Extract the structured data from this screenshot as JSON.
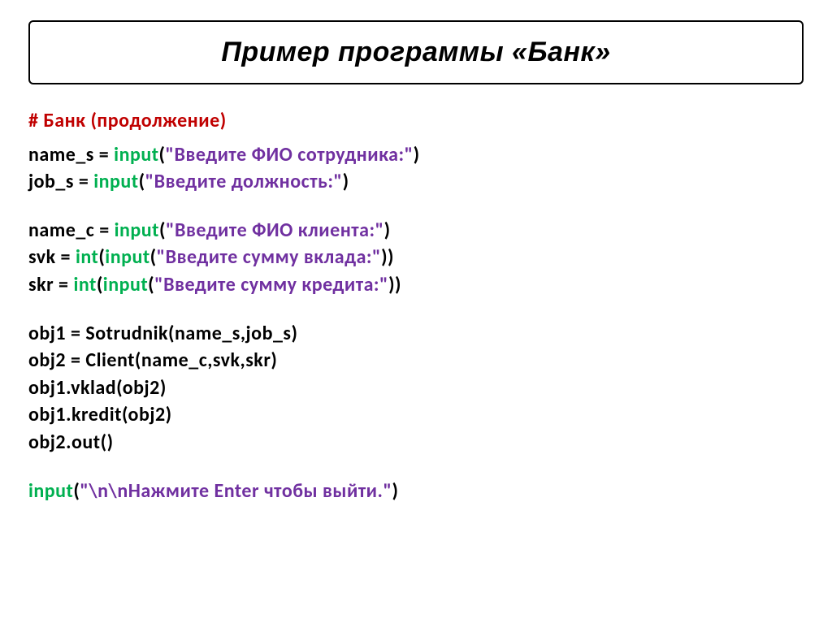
{
  "title": "Пример программы «Банк»",
  "code": {
    "comment": "# Банк (продолжение)",
    "l1": {
      "a": "name_s = ",
      "b": "input",
      "c": "(",
      "d": "\"Введите ФИО сотрудника:\"",
      "e": ")"
    },
    "l2": {
      "a": "job_s  = ",
      "b": "input",
      "c": "(",
      "d": "\"Введите должность:\"",
      "e": ")"
    },
    "l3": {
      "a": "name_c = ",
      "b": "input",
      "c": "(",
      "d": "\"Введите ФИО клиента:\"",
      "e": ")"
    },
    "l4": {
      "a": "svk = ",
      "b": "int",
      "c": "(",
      "d": "input",
      "e": "(",
      "f": "\"Введите сумму вклада:\"",
      "g": "))"
    },
    "l5": {
      "a": "skr = ",
      "b": "int",
      "c": "(",
      "d": "input",
      "e": "(",
      "f": "\"Введите сумму кредита:\"",
      "g": "))"
    },
    "l6": "obj1 = Sotrudnik(name_s,job_s)",
    "l7": "obj2 = Client(name_c,svk,skr)",
    "l8": "obj1.vklad(obj2)",
    "l9": "obj1.kredit(obj2)",
    "l10": "obj2.out()",
    "l11": {
      "a": "input",
      "b": "(",
      "c": "\"\\n\\nНажмите Enter чтобы выйти.\"",
      "d": ")"
    }
  }
}
